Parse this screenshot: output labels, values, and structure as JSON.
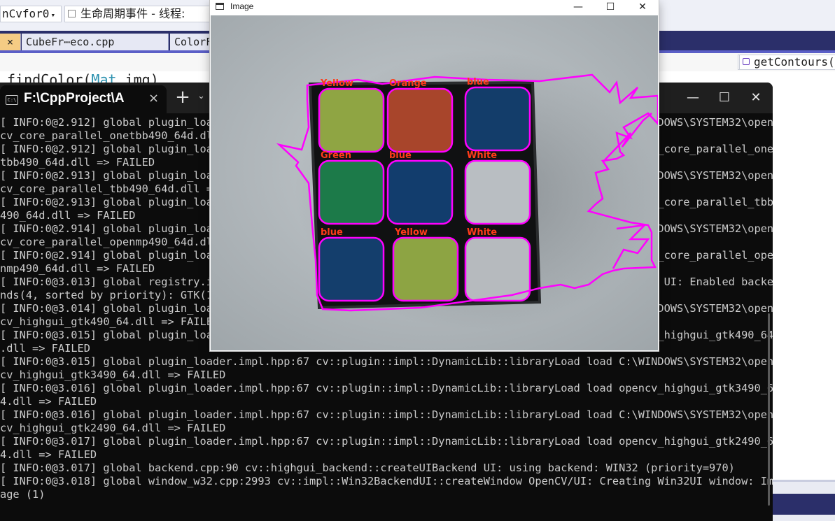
{
  "vs": {
    "project_combo": "nCvfor0",
    "combo_arrow": "▾",
    "function_combo": "生命周期事件 - 线程:",
    "tabs": [
      {
        "close": "×",
        "label": ""
      },
      {
        "label": "CubeFr⋯eco.cpp"
      },
      {
        "label": "ColorF"
      }
    ],
    "member_combo": "getContours(",
    "code_line": {
      "name": "findColor",
      "open": "(",
      "type": "Mat",
      "arg": " img)"
    }
  },
  "terminal": {
    "title": "F:\\CppProject\\A",
    "tab_icon": "C:\\",
    "close_tab": "×",
    "new_tab": "+",
    "dropdown": "⌄",
    "controls": {
      "minimize": "—",
      "maximize": "☐",
      "close": "✕"
    },
    "lines": [
      "[ INFO:0@2.912] global plugin_loader.impl.hpp:67 cv::plugin::impl::DynamicLib::libraryLoad load C:\\WINDOWS\\SYSTEM32\\open",
      "cv_core_parallel_onetbb490_64d.dll => FAILED",
      "[ INFO:0@2.912] global plugin_loader.impl.hpp:67 cv::plugin::impl::DynamicLib::libraryLoad load opencv_core_parallel_one",
      "tbb490_64d.dll => FAILED",
      "[ INFO:0@2.913] global plugin_loader.impl.hpp:67 cv::plugin::impl::DynamicLib::libraryLoad load C:\\WINDOWS\\SYSTEM32\\open",
      "cv_core_parallel_tbb490_64d.dll => FAILED",
      "[ INFO:0@2.913] global plugin_loader.impl.hpp:67 cv::plugin::impl::DynamicLib::libraryLoad load opencv_core_parallel_tbb",
      "490_64d.dll => FAILED",
      "[ INFO:0@2.914] global plugin_loader.impl.hpp:67 cv::plugin::impl::DynamicLib::libraryLoad load C:\\WINDOWS\\SYSTEM32\\open",
      "cv_core_parallel_openmp490_64d.dll => FAILED",
      "[ INFO:0@2.914] global plugin_loader.impl.hpp:67 cv::plugin::impl::DynamicLib::libraryLoad load opencv_core_parallel_ope",
      "nmp490_64d.dll => FAILED",
      "[ INFO:0@3.013] global registry.impl.hpp:114 cv::highgui_backend::UIBackendRegistry::UIBackendRegistry UI: Enabled backe",
      "nds(4, sorted by priority): GTK(1000); GTK3(990); GTK2(980); WIN32(970) + BUILTIN(WIN32UI)",
      "[ INFO:0@3.014] global plugin_loader.impl.hpp:67 cv::plugin::impl::DynamicLib::libraryLoad load C:\\WINDOWS\\SYSTEM32\\open",
      "cv_highgui_gtk490_64.dll => FAILED",
      "[ INFO:0@3.015] global plugin_loader.impl.hpp:67 cv::plugin::impl::DynamicLib::libraryLoad load opencv_highgui_gtk490_64",
      ".dll => FAILED",
      "[ INFO:0@3.015] global plugin_loader.impl.hpp:67 cv::plugin::impl::DynamicLib::libraryLoad load C:\\WINDOWS\\SYSTEM32\\open",
      "cv_highgui_gtk3490_64.dll => FAILED",
      "[ INFO:0@3.016] global plugin_loader.impl.hpp:67 cv::plugin::impl::DynamicLib::libraryLoad load opencv_highgui_gtk3490_6",
      "4.dll => FAILED",
      "[ INFO:0@3.016] global plugin_loader.impl.hpp:67 cv::plugin::impl::DynamicLib::libraryLoad load C:\\WINDOWS\\SYSTEM32\\open",
      "cv_highgui_gtk2490_64.dll => FAILED",
      "[ INFO:0@3.017] global plugin_loader.impl.hpp:67 cv::plugin::impl::DynamicLib::libraryLoad load opencv_highgui_gtk2490_6",
      "4.dll => FAILED",
      "[ INFO:0@3.017] global backend.cpp:90 cv::highgui_backend::createUIBackend UI: using backend: WIN32 (priority=970)",
      "[ INFO:0@3.018] global window_w32.cpp:2993 cv::impl::Win32BackendUI::createWindow OpenCV/UI: Creating Win32UI window: Im",
      "age (1)"
    ]
  },
  "image_window": {
    "title": "Image",
    "controls": {
      "minimize": "—",
      "maximize": "☐",
      "close": "✕"
    },
    "labels": [
      "Yellow",
      "Orange",
      "blue",
      "Green",
      "blue",
      "White",
      "blue",
      "Yellow",
      "White"
    ],
    "sticker_colors": [
      "#8fa543",
      "#a8452b",
      "#133d6a",
      "#1c7a49",
      "#123d6d",
      "#b9bec2",
      "#143e6c",
      "#8da443",
      "#b6babe"
    ],
    "contour_color": "#ff00ff",
    "label_color": "#ff3b1a"
  }
}
